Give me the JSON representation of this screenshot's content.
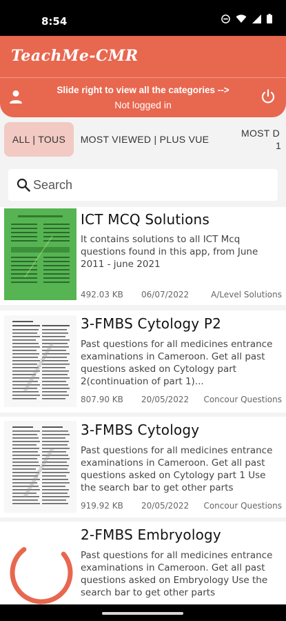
{
  "status_bar": {
    "time": "8:54"
  },
  "header": {
    "app_title": "TeachMe-CMR",
    "slide_hint": "Slide right to view all the categories -->",
    "login_status": "Not logged in"
  },
  "tabs": [
    {
      "label": "ALL | TOUS"
    },
    {
      "label": "MOST VIEWED | PLUS VUE"
    },
    {
      "label_line1": "MOST D",
      "label_line2": "1"
    }
  ],
  "search": {
    "placeholder": "Search"
  },
  "documents": [
    {
      "title": "ICT MCQ Solutions",
      "description": "It contains solutions to all ICT Mcq questions found in this app, from June 2011 - june 2021",
      "size": "492.03 KB",
      "date": "06/07/2022",
      "category": "A/Level Solutions"
    },
    {
      "title": "3-FMBS Cytology P2",
      "description": "Past questions for all medicines entrance examinations in Cameroon. Get all past questions asked on Cytology part 2(continuation of part 1)...",
      "size": "807.90 KB",
      "date": "20/05/2022",
      "category": "Concour Questions"
    },
    {
      "title": "3-FMBS Cytology",
      "description": "Past questions for all medicines entrance examinations in Cameroon. Get all past questions asked on Cytology part 1 Use the search bar to get other parts",
      "size": "919.92 KB",
      "date": "20/05/2022",
      "category": "Concour Questions"
    },
    {
      "title": "2-FMBS Embryology",
      "description": "Past questions for all medicines entrance examinations in Cameroon. Get all past questions asked on Embryology Use the search bar to get other parts"
    }
  ],
  "icons": {
    "user": "user-icon",
    "power": "power-icon",
    "search": "search-icon",
    "loading": "loading-spinner-icon"
  },
  "colors": {
    "primary": "#e8674f",
    "active_tab": "#f2c9c3",
    "thumb_green": "#56b453"
  }
}
